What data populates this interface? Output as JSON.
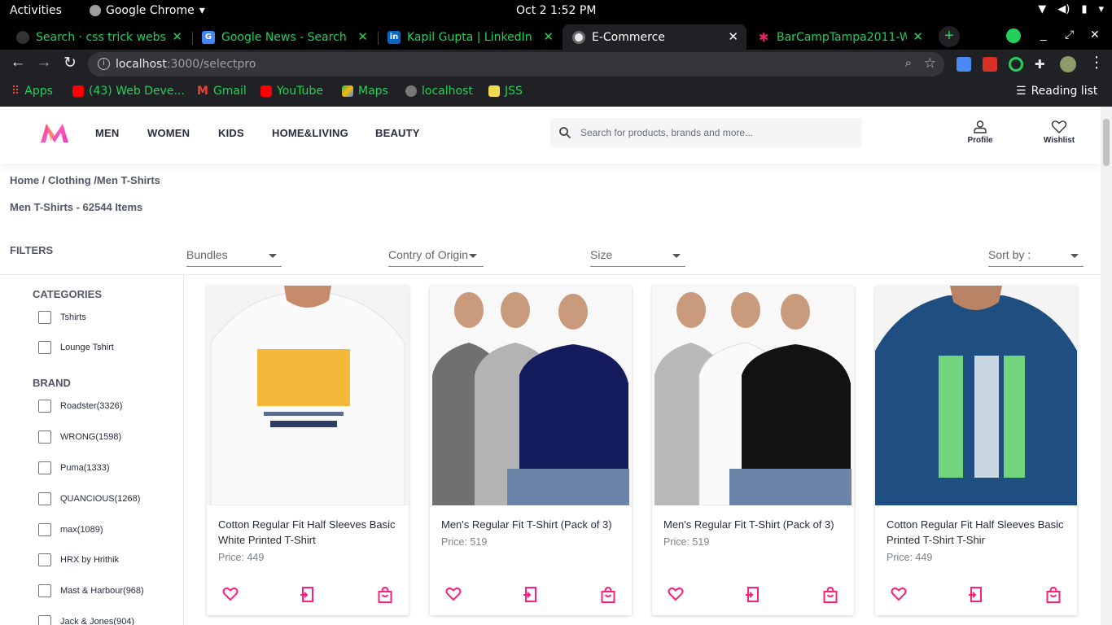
{
  "os": {
    "activities": "Activities",
    "app_name": "Google Chrome",
    "clock": "Oct 2   1:52 PM"
  },
  "browser": {
    "tabs": [
      {
        "title": "Search · css trick websit",
        "favicon": "github-icon",
        "active": false
      },
      {
        "title": "Google News - Search",
        "favicon": "google-news-icon",
        "active": false
      },
      {
        "title": "Kapil Gupta | LinkedIn",
        "favicon": "linkedin-icon",
        "active": false
      },
      {
        "title": "E-Commerce",
        "favicon": "localhost-icon",
        "active": true
      },
      {
        "title": "BarCampTampa2011-W",
        "favicon": "barcamp-icon",
        "active": false
      }
    ],
    "url_host": "localhost",
    "url_path": ":3000/selectpro",
    "bookmarks": [
      "Apps",
      "(43) Web Deve...",
      "Gmail",
      "YouTube",
      "Maps",
      "localhost",
      "JSS"
    ],
    "reading_list": "Reading list"
  },
  "colors": {
    "accent": "#ff3f6c",
    "browser_green": "#23d05a",
    "text_dark": "#282c3f",
    "text_muted": "#7e818c"
  },
  "header": {
    "nav": [
      "MEN",
      "WOMEN",
      "KIDS",
      "HOME&LIVING",
      "BEAUTY"
    ],
    "search_placeholder": "Search for products, brands and more...",
    "profile_label": "Profile",
    "wishlist_label": "Wishlist"
  },
  "listing": {
    "breadcrumb": "Home / Clothing /Men T-Shirts",
    "title": "Men T-Shirts - 62544 Items",
    "filters_label": "FILTERS",
    "dropdowns": [
      "Bundles",
      "Contry of Origin",
      "Size"
    ],
    "sort_label": "Sort by :"
  },
  "sidebar": {
    "categories_title": "CATEGORIES",
    "categories": [
      "Tshirts",
      "Lounge Tshirt"
    ],
    "brand_title": "BRAND",
    "brands": [
      "Roadster(3326)",
      "WRONG(1598)",
      "Puma(1333)",
      "QUANCIOUS(1268)",
      "max(1089)",
      "HRX by Hrithik",
      "Mast & Harbour(968)",
      "Jack & Jones(904)"
    ]
  },
  "products": [
    {
      "name": "Cotton Regular Fit Half Sleeves Basic White Printed T-Shirt",
      "price": "Price: 449",
      "image": "white-printed-tshirt"
    },
    {
      "name": "Men's Regular Fit T-Shirt (Pack of 3)",
      "price": "Price: 519",
      "image": "three-pack-grey-navy"
    },
    {
      "name": "Men's Regular Fit T-Shirt (Pack of 3)",
      "price": "Price: 519",
      "image": "three-pack-grey-black"
    },
    {
      "name": "Cotton Regular Fit Half Sleeves Basic Printed T-Shirt T-Shir",
      "price": "Price: 449",
      "image": "blue-printed-tshirt"
    }
  ]
}
